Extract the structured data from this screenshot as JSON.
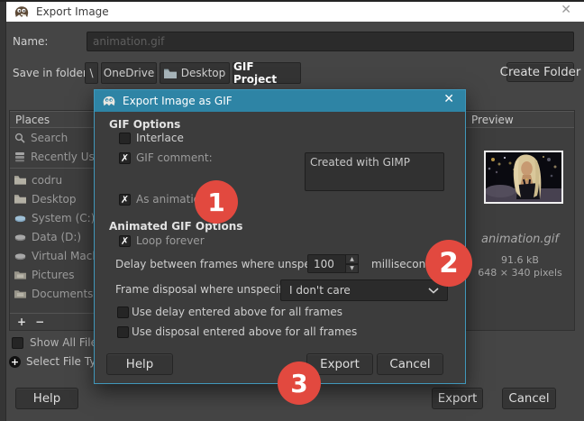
{
  "glyphs": {
    "check": "✗",
    "close": "✕",
    "up": "▲",
    "down": "▼",
    "chevron": "⌄"
  },
  "colors": {
    "titlebar_teal": "#2e84a5",
    "annotation_red": "#e2493f",
    "window_bg": "#454545",
    "dialog_bg": "#3c3c3c",
    "dialog_border": "#4097ba",
    "titlebar_white": "#ffffff"
  },
  "window": {
    "title": "Export Image"
  },
  "name_row": {
    "label": "Name:",
    "value": "animation.gif"
  },
  "save_row": {
    "label": "Save in folder:",
    "crumbs": [
      "\\",
      "OneDrive",
      "Desktop",
      "GIF Project"
    ],
    "create_folder": "Create Folder"
  },
  "places": {
    "header": "Places",
    "items": [
      {
        "icon": "search-icon",
        "label": "Search"
      },
      {
        "icon": "recent-icon",
        "label": "Recently Used"
      },
      {
        "icon": "folder-icon",
        "label": "codru"
      },
      {
        "icon": "folder-icon",
        "label": "Desktop"
      },
      {
        "icon": "drive-icon",
        "label": "System (C:)"
      },
      {
        "icon": "drive-icon",
        "label": "Data (D:)"
      },
      {
        "icon": "drive-icon",
        "label": "Virtual Machines"
      },
      {
        "icon": "folder-icon",
        "label": "Pictures"
      },
      {
        "icon": "folder-icon",
        "label": "Documents"
      }
    ],
    "add": "+",
    "remove": "−"
  },
  "bottom_left": {
    "show_all_files": "Show All Files",
    "select_file_type": "Select File Type",
    "expander": "+"
  },
  "footer": {
    "help": "Help",
    "export": "Export",
    "cancel": "Cancel"
  },
  "preview": {
    "header": "Preview",
    "filename": "animation.gif",
    "filesize": "91.6 kB",
    "dimensions": "648 × 340 pixels"
  },
  "gif_dialog": {
    "title": "Export Image as GIF",
    "gif_options_heading": "GIF Options",
    "interlace": "Interlace",
    "gif_comment": "GIF comment:",
    "comment_value": "Created with GIMP",
    "as_animation": "As animation",
    "animated_heading": "Animated GIF Options",
    "loop_forever": "Loop forever",
    "delay_label": "Delay between frames where unspecified:",
    "delay_value": "100",
    "delay_unit": "milliseconds",
    "disposal_label": "Frame disposal where unspecified:",
    "disposal_value": "I don't care",
    "use_delay": "Use delay entered above for all frames",
    "use_disposal": "Use disposal entered above for all frames",
    "help": "Help",
    "export": "Export",
    "cancel": "Cancel"
  },
  "states": {
    "interlace": false,
    "gif_comment": true,
    "as_animation": true,
    "loop_forever": true,
    "use_delay": false,
    "use_disposal": false,
    "show_all_files": false
  },
  "annotations": {
    "one": "1",
    "two": "2",
    "three": "3"
  }
}
